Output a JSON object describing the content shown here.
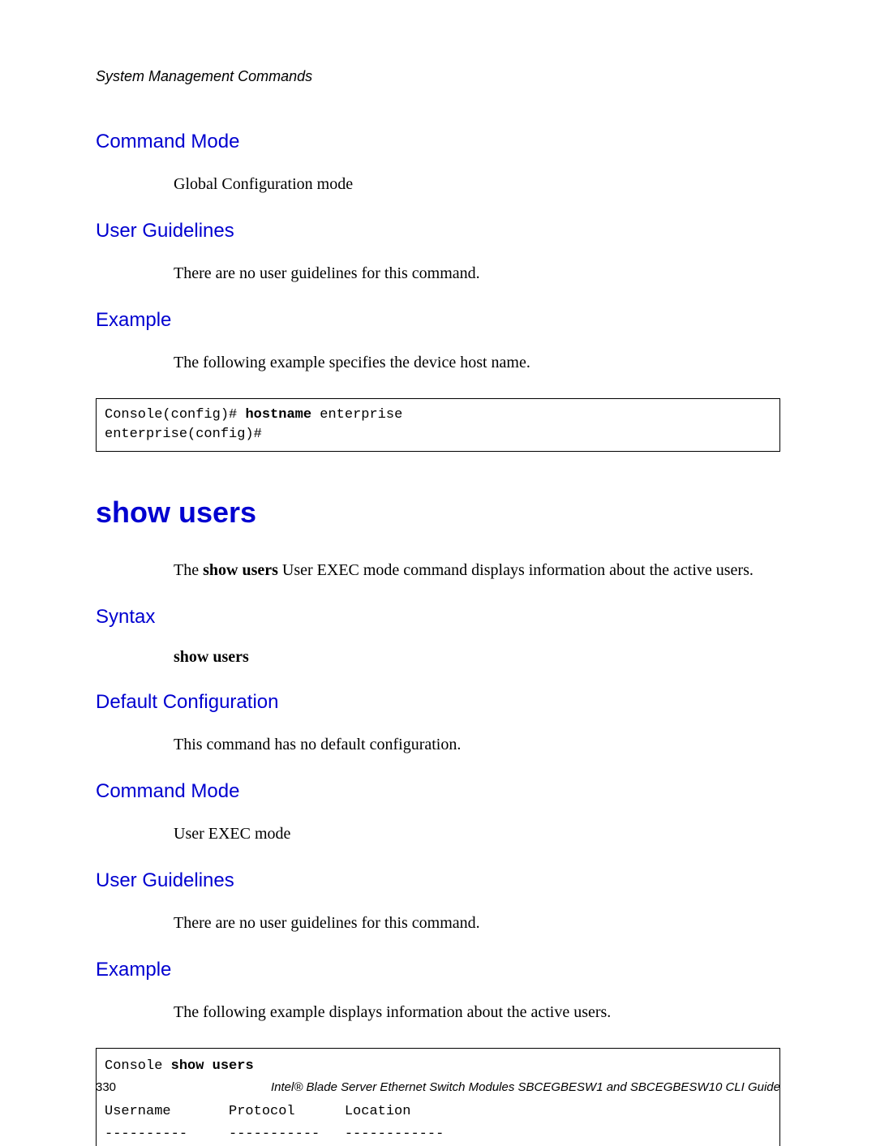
{
  "header": {
    "category": "System Management Commands"
  },
  "sections": {
    "command_mode_1": {
      "heading": "Command Mode",
      "text": "Global Configuration mode"
    },
    "user_guidelines_1": {
      "heading": "User Guidelines",
      "text": "There are no user guidelines for this command."
    },
    "example_1": {
      "heading": "Example",
      "text": "The following example specifies the device host name.",
      "code_prefix": "Console(config)# ",
      "code_bold": "hostname",
      "code_suffix": " enterprise\nenterprise(config)#"
    },
    "main": {
      "heading": "show users",
      "intro_pre": "The ",
      "intro_bold": "show users",
      "intro_post": " User EXEC mode command displays information about the active users."
    },
    "syntax": {
      "heading": "Syntax",
      "command": "show users"
    },
    "default_config": {
      "heading": "Default Configuration",
      "text": "This command has no default configuration."
    },
    "command_mode_2": {
      "heading": "Command Mode",
      "text": "User EXEC mode"
    },
    "user_guidelines_2": {
      "heading": "User Guidelines",
      "text": "There are no user guidelines for this command."
    },
    "example_2": {
      "heading": "Example",
      "text": "The following example displays information about the active users.",
      "code_prefix": "Console ",
      "code_bold": "show users",
      "code_table": "\n\nUsername       Protocol      Location\n----------     -----------   ------------"
    }
  },
  "footer": {
    "page": "330",
    "text": "Intel® Blade Server Ethernet Switch Modules SBCEGBESW1 and SBCEGBESW10 CLI Guide"
  }
}
